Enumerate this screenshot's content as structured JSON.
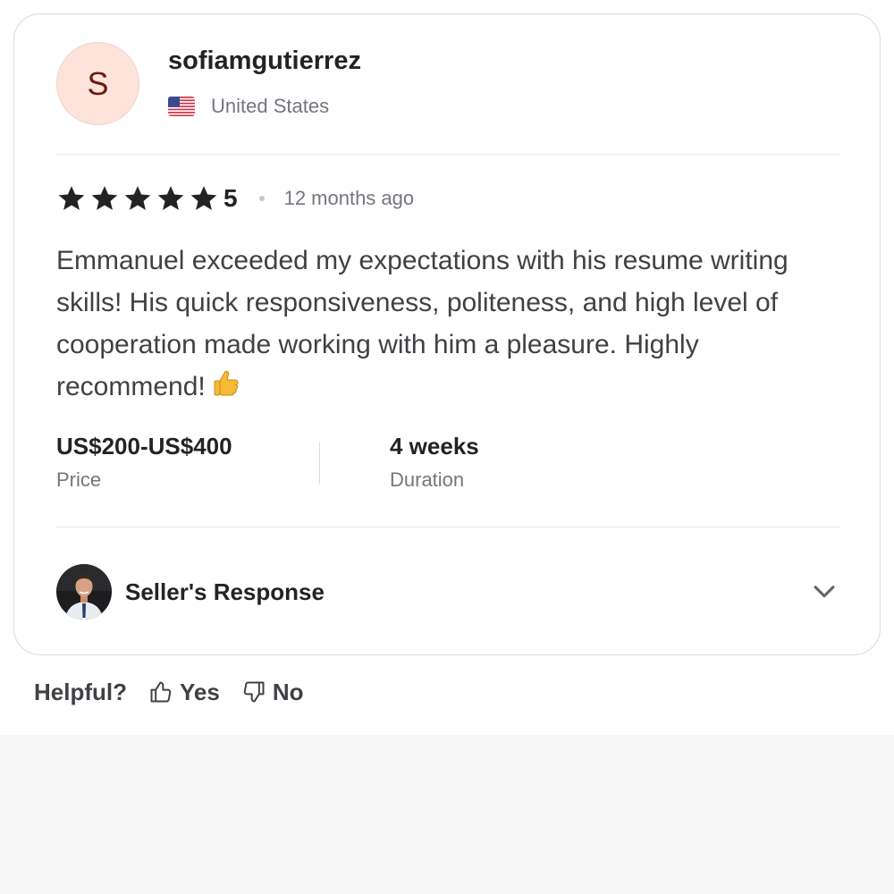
{
  "reviewer": {
    "avatar_initial": "S",
    "username": "sofiamgutierrez",
    "country": "United States",
    "flag_icon": "us-flag-icon"
  },
  "review": {
    "stars": 5,
    "rating_value": "5",
    "time_ago": "12 months ago",
    "text": "Emmanuel exceeded my expectations with his resume writing skills! His quick responsiveness, politeness, and high level of cooperation made working with him a pleasure. Highly recommend!",
    "emoji": "👍"
  },
  "meta": {
    "price_value": "US$200-US$400",
    "price_label": "Price",
    "duration_value": "4 weeks",
    "duration_label": "Duration"
  },
  "seller_response": {
    "label": "Seller's Response",
    "avatar_icon": "seller-avatar",
    "toggle_icon": "chevron-down-icon"
  },
  "helpful": {
    "question": "Helpful?",
    "yes_label": "Yes",
    "no_label": "No"
  },
  "colors": {
    "avatar_bg": "#fde3da",
    "avatar_text": "#6a1c0f",
    "text_primary": "#222325",
    "text_secondary": "#74767e",
    "border": "#dadbdd",
    "page_bottom_bg": "#f7f7f8"
  }
}
